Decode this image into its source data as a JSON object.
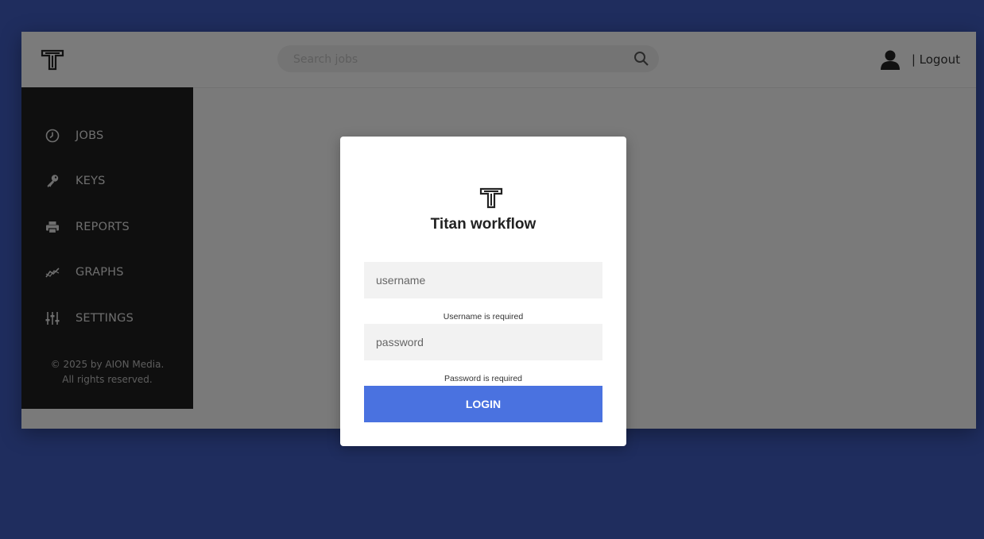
{
  "header": {
    "logo_icon": "titan-logo",
    "search": {
      "placeholder": "Search jobs",
      "value": "",
      "icon": "search-icon"
    },
    "user_icon": "user-icon",
    "logout_label": "| Logout"
  },
  "sidebar": {
    "items": [
      {
        "label": "JOBS",
        "icon": "clock-icon"
      },
      {
        "label": "KEYS",
        "icon": "key-icon"
      },
      {
        "label": "REPORTS",
        "icon": "printer-icon"
      },
      {
        "label": "GRAPHS",
        "icon": "chart-line-icon"
      },
      {
        "label": "SETTINGS",
        "icon": "sliders-icon"
      }
    ],
    "copyright_line1": "© 2025 by AION Media.",
    "copyright_line2": "All rights reserved."
  },
  "modal": {
    "title": "Titan workflow",
    "username": {
      "placeholder": "username",
      "value": "",
      "error": "Username is required"
    },
    "password": {
      "placeholder": "password",
      "value": "",
      "error": "Password is required"
    },
    "login_label": "LOGIN"
  },
  "colors": {
    "page_bg": "#1f2d5e",
    "sidebar_bg": "#1f1f1f",
    "login_button": "#4a72e0"
  }
}
